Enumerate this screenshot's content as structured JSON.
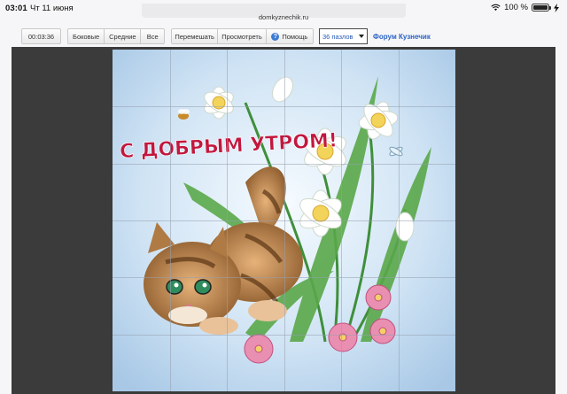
{
  "status": {
    "time": "03:01",
    "date": "Чт 11 июня",
    "battery": "100 %"
  },
  "browser": {
    "url": "domkyznechik.ru"
  },
  "toolbar": {
    "timer": "00:03:36",
    "edges": "Боковые",
    "middle": "Средние",
    "all": "Все",
    "shuffle": "Перемешать",
    "preview": "Просмотреть",
    "help_icon": "?",
    "help": "Помощь",
    "pieces": "36 пазлов",
    "forum": "Форум Кузнечик"
  },
  "puzzle": {
    "image_text": "С ДОБРЫМ УТРОМ!",
    "grid": {
      "rows": 6,
      "cols": 6
    }
  },
  "colors": {
    "board": "#3b3b3b",
    "accent": "#2a62c4",
    "title_text": "#c2173e"
  }
}
